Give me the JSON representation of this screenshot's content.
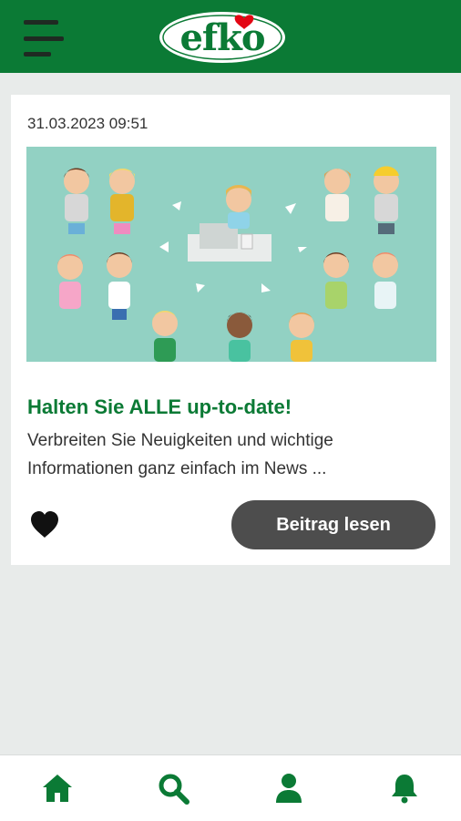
{
  "header": {
    "logo_text": "efko",
    "colors": {
      "brand_green": "#0b7a35",
      "logo_heart": "#e30613"
    }
  },
  "post": {
    "date": "31.03.2023 09:51",
    "title": "Halten Sie ALLE up-to-date!",
    "excerpt": "Verbreiten Sie Neuigkeiten und wichtige Informationen ganz einfach im News ...",
    "read_button_label": "Beitrag lesen",
    "liked": true
  },
  "bottom_nav": {
    "items": [
      {
        "icon": "home-icon"
      },
      {
        "icon": "search-icon"
      },
      {
        "icon": "user-icon"
      },
      {
        "icon": "bell-icon"
      }
    ]
  }
}
